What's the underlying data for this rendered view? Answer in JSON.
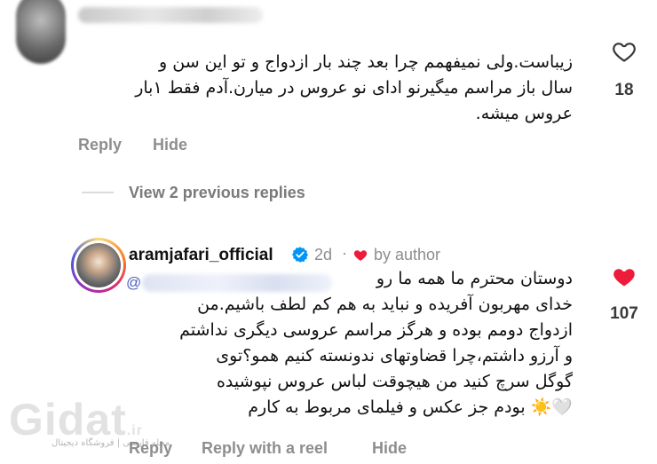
{
  "comment": {
    "text_lines": [
      "زیباست.ولی نمیفهمم چرا بعد چند بار ازدواج و تو این سن و",
      "سال باز مراسم میگیرنو ادای نو عروس در میارن.آدم فقط ۱بار",
      "عروس میشه."
    ],
    "like_count": "18",
    "reply_label": "Reply",
    "hide_label": "Hide"
  },
  "replies_toggle": {
    "label": "View 2 previous replies"
  },
  "reply": {
    "username": "aramjafari_official",
    "time": "2d",
    "separator": "·",
    "author_label": "by author",
    "text_lines": [
      "دوستان محترم ما همه ما رو",
      "خدای مهربون آفریده و نباید به هم کم لطف باشیم.من",
      "ازدواج دومم بوده و هرگز مراسم عروسی دیگری نداشتم",
      "و آرزو داشتم،چرا قضاوتهای ندونسته کنیم همو؟توی",
      "گوگل سرچ کنید من هیچوقت لباس عروس نپوشیده",
      "بودم جز عکس و فیلمای مربوط به کارم"
    ],
    "emojis": "🤍☀️",
    "like_count": "107",
    "reply_label": "Reply",
    "reel_label": "Reply with a reel",
    "hide_label": "Hide"
  },
  "watermark": {
    "brand": "Gidat",
    "domain": ".ir",
    "tagline": "مجله فارسی | فروشگاه دیجیتال"
  },
  "colors": {
    "like_red": "#ed1c3a",
    "muted": "#8e8e8e",
    "verified_blue": "#0095f6"
  }
}
